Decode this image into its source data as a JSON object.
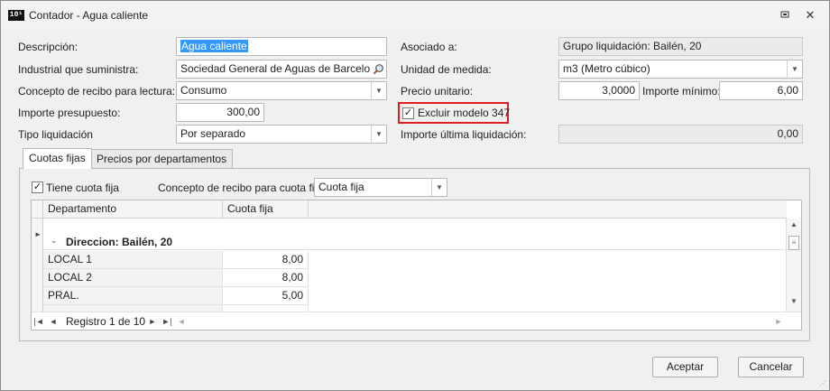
{
  "window": {
    "title": "Contador - Agua caliente",
    "app_icon_text": "10¹"
  },
  "form": {
    "descripcion": {
      "label": "Descripción:",
      "value": "Agua caliente"
    },
    "industrial": {
      "label": "Industrial que suministra:",
      "value": "Sociedad General de Aguas de Barcelona, S"
    },
    "concepto_recibo": {
      "label": "Concepto de recibo para lectura:",
      "value": "Consumo"
    },
    "importe_presupuesto": {
      "label": "Importe presupuesto:",
      "value": "300,00"
    },
    "tipo_liquidacion": {
      "label": "Tipo liquidación",
      "value": "Por separado"
    },
    "asociado": {
      "label": "Asociado a:",
      "value": "Grupo liquidación: Bailén, 20"
    },
    "unidad_medida": {
      "label": "Unidad de medida:",
      "value": "m3 (Metro cúbico)"
    },
    "precio_unitario": {
      "label": "Precio unitario:",
      "value": "3,0000"
    },
    "importe_minimo": {
      "label": "Importe mínimo:",
      "value": "6,00"
    },
    "excluir_347": {
      "label": "Excluir modelo 347",
      "checked": true
    },
    "importe_ultima": {
      "label": "Importe última liquidación:",
      "value": "0,00"
    }
  },
  "tabs": [
    {
      "label": "Cuotas fijas",
      "active": true
    },
    {
      "label": "Precios por departamentos",
      "active": false
    }
  ],
  "cuotas": {
    "tiene_cuota_fija": {
      "label": "Tiene cuota fija",
      "checked": true
    },
    "concepto_cuota": {
      "label": "Concepto de recibo para cuota fija:",
      "value": "Cuota fija"
    }
  },
  "grid": {
    "columns": [
      "Departamento",
      "Cuota fija"
    ],
    "group_label": "Direccion: Bailén, 20",
    "rows": [
      {
        "departamento": "LOCAL 1",
        "cuota": "8,00"
      },
      {
        "departamento": "LOCAL 2",
        "cuota": "8,00"
      },
      {
        "departamento": "PRAL.",
        "cuota": "5,00"
      }
    ],
    "nav_text": "Registro 1 de 10"
  },
  "buttons": {
    "accept": "Aceptar",
    "cancel": "Cancelar"
  },
  "colors": {
    "highlight_box": "#e0201e",
    "selection": "#3399ff"
  }
}
